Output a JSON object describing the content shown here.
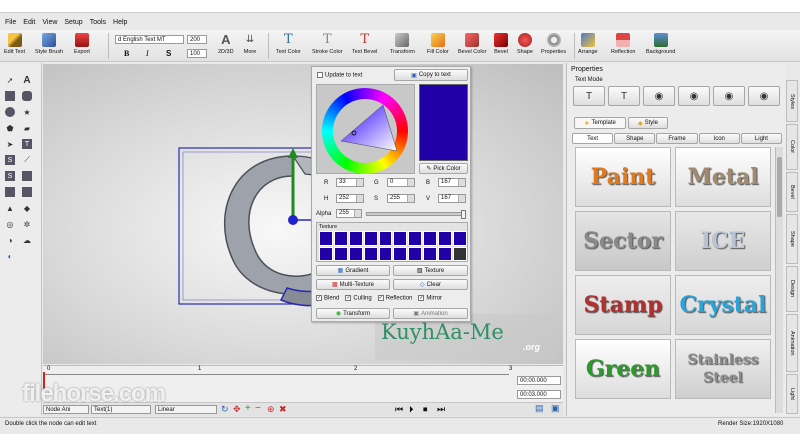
{
  "menu": [
    "File",
    "Edit",
    "View",
    "Setup",
    "Tools",
    "Help"
  ],
  "toolbar": {
    "edit_text": "Edit Text",
    "style_brush": "Style Brush",
    "export": "Export",
    "font_name": "d English Text MT",
    "font_size": "200",
    "scale": "100",
    "mode_2d3d": "2D/3D",
    "more": "More",
    "bold": "B",
    "italic": "I",
    "strike": "S",
    "text_color": "Text Color",
    "stroke_color": "Stroke Color",
    "text_bevel": "Text Bevel",
    "transform": "Transform",
    "fill_color": "Fill Color",
    "bevel_color": "Bevel Color",
    "bevel": "Bevel",
    "shape": "Shape",
    "properties": "Properties",
    "arrange": "Arrange",
    "reflection": "Reflection",
    "background": "Background"
  },
  "color_panel": {
    "update_to_text": "Update to text",
    "copy_to_text": "Copy to text",
    "pick_color": "Pick Color",
    "r_label": "R",
    "r": "33",
    "g_label": "G",
    "g": "0",
    "b_label": "B",
    "b": "167",
    "h_label": "H",
    "h": "252",
    "s_label": "S",
    "s": "255",
    "v_label": "V",
    "v": "167",
    "alpha_label": "Alpha",
    "alpha": "255",
    "alpha_level": 1.0,
    "texture_label": "Texture",
    "gradient": "Gradient",
    "texture": "Texture",
    "multi_texture": "Multi-Texture",
    "clear": "Clear",
    "blend": "Blend",
    "culling": "Culling",
    "reflection": "Reflection",
    "mirror": "Mirror",
    "transform": "Transform",
    "animation": "Animation",
    "selected_color": "#2100a7"
  },
  "timeline": {
    "ticks": [
      "0",
      "1",
      "2",
      "3"
    ],
    "time1": "00:00.000",
    "time2": "00:03.000",
    "node_select": "Node Ani",
    "text_select": "Text(1)",
    "interp": "Linear"
  },
  "status": {
    "hint": "Double click the node can edit text",
    "render_size": "Render Size:1920X1080"
  },
  "right_panel": {
    "title": "Properties",
    "text_mode": "Text Mode",
    "tab_template": "Template",
    "tab_style": "Style",
    "subtabs": [
      "Text",
      "Shape",
      "Frame",
      "Icon",
      "Light"
    ],
    "templates": [
      "Paint",
      "Metal",
      "Sector",
      "ICE",
      "Stamp",
      "Crystal",
      "Green",
      "Stainless Steel"
    ]
  },
  "side_tabs": [
    "Styles",
    "Color",
    "Bevel",
    "Shape",
    "Design",
    "Animation",
    "Light"
  ],
  "watermark": {
    "site": "KuyhAa-Me",
    "tld": ".org",
    "brand": "filehorse.com"
  }
}
